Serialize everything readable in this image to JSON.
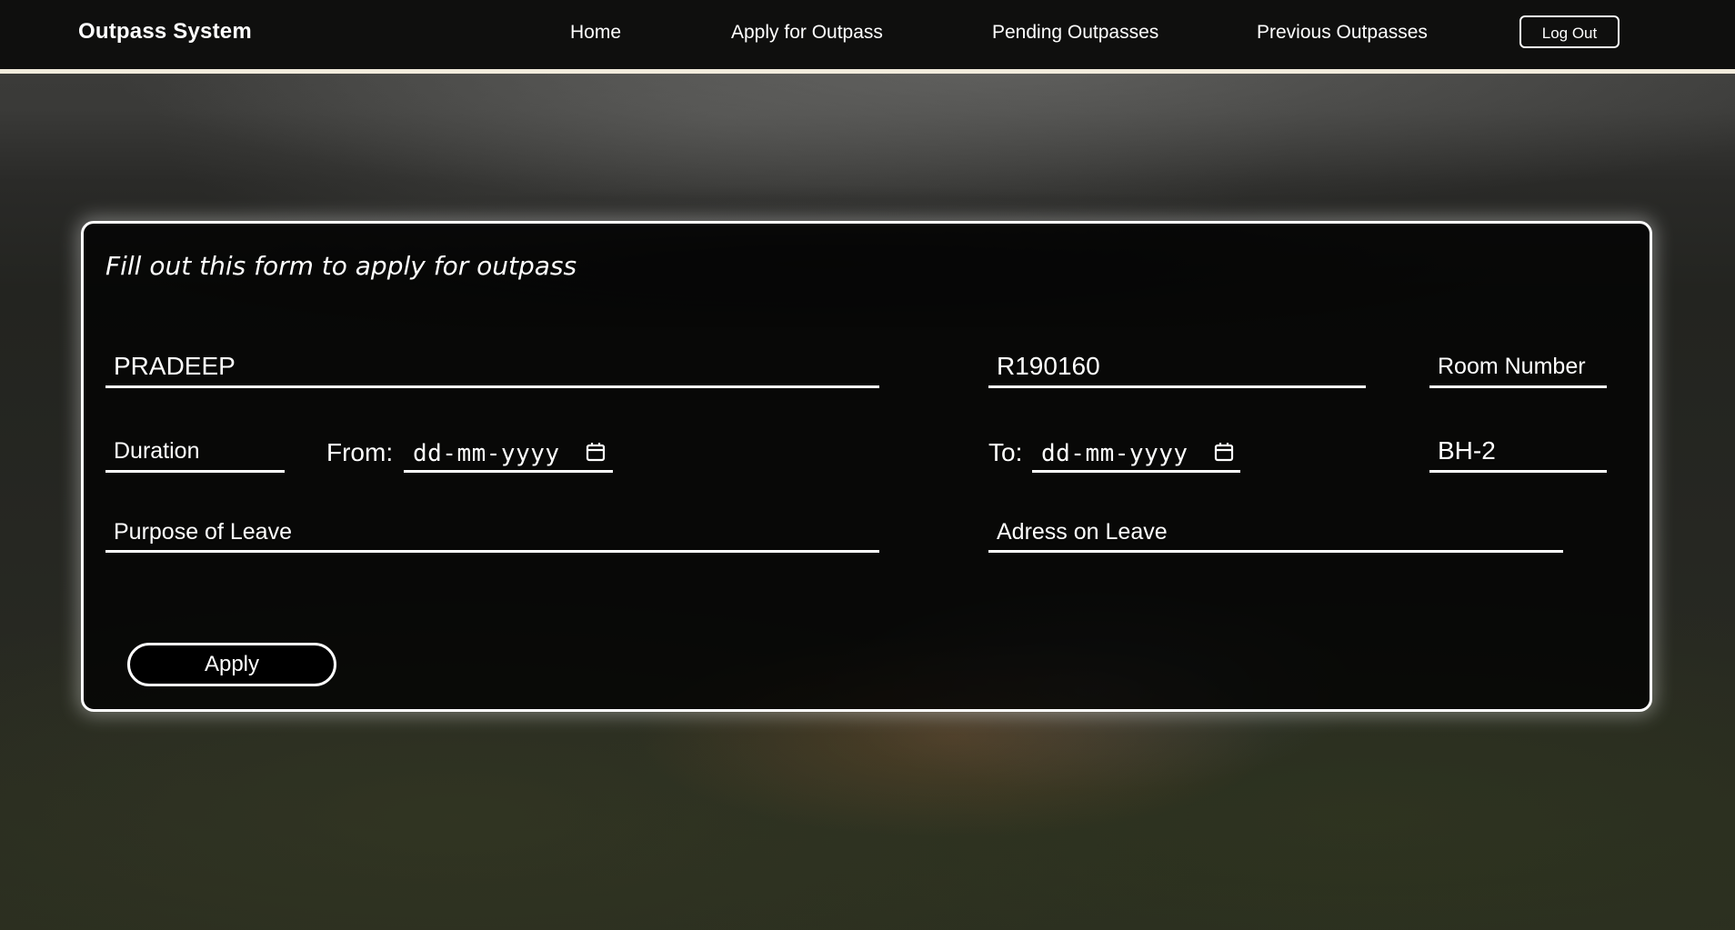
{
  "navbar": {
    "brand": "Outpass System",
    "links": [
      "Home",
      "Apply for Outpass",
      "Pending Outpasses",
      "Previous Outpasses"
    ],
    "logout_label": "Log Out"
  },
  "form": {
    "title": "Fill out this form to apply for outpass",
    "name_value": "PRADEEP",
    "id_value": "R190160",
    "room_placeholder": "Room Number",
    "duration_placeholder": "Duration",
    "from_label": "From:",
    "from_placeholder": "dd-mm-yyyy",
    "to_label": "To:",
    "to_placeholder": "dd-mm-yyyy",
    "hostel_value": "BH-2",
    "purpose_placeholder": "Purpose of Leave",
    "address_placeholder": "Adress on Leave",
    "apply_label": "Apply"
  },
  "icons": {
    "calendar": "calendar-icon"
  }
}
